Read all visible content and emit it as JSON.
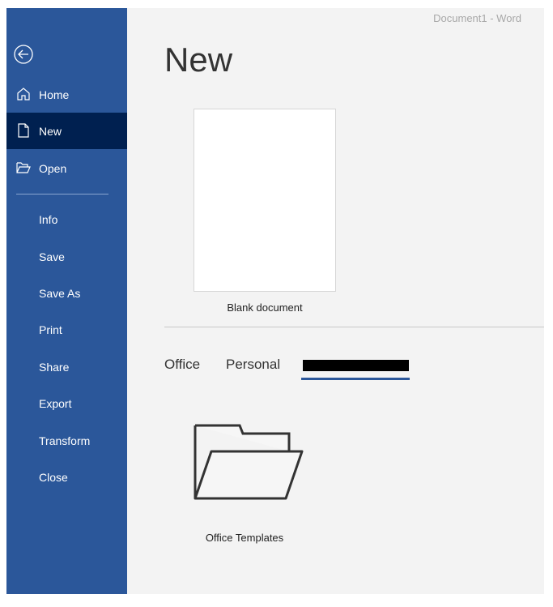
{
  "window_title": "Document1  -  Word",
  "sidebar": {
    "items": [
      {
        "label": "Home",
        "icon": "home-icon"
      },
      {
        "label": "New",
        "icon": "new-document-icon",
        "selected": true
      },
      {
        "label": "Open",
        "icon": "open-folder-icon"
      },
      {
        "label": "Info"
      },
      {
        "label": "Save"
      },
      {
        "label": "Save As"
      },
      {
        "label": "Print"
      },
      {
        "label": "Share"
      },
      {
        "label": "Export"
      },
      {
        "label": "Transform"
      },
      {
        "label": "Close"
      }
    ]
  },
  "main": {
    "title": "New",
    "blank_label": "Blank document",
    "tabs": [
      {
        "label": "Office"
      },
      {
        "label": "Personal"
      }
    ],
    "folder_label": "Office Templates"
  },
  "colors": {
    "sidebar": "#2b579a",
    "selected": "#002050"
  }
}
